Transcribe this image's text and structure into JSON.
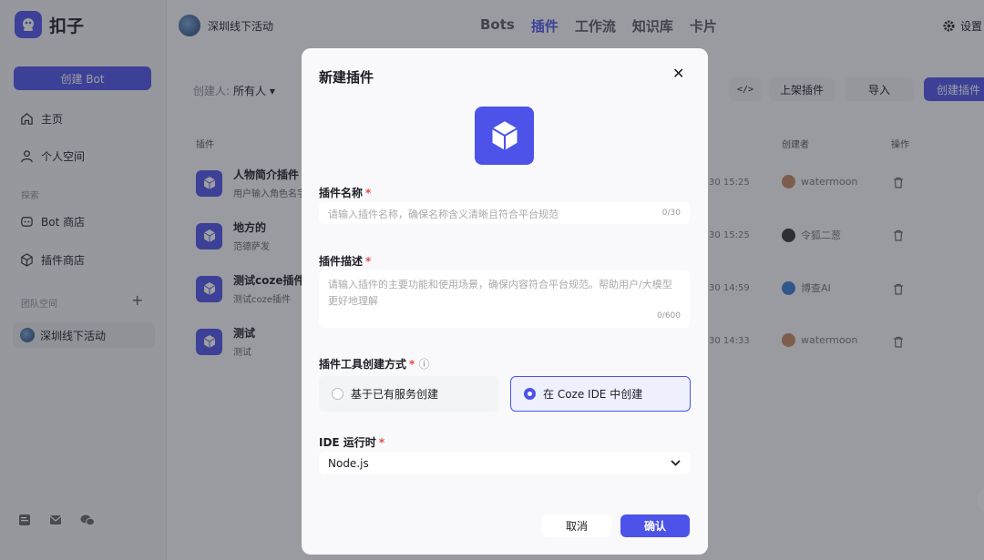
{
  "app": {
    "name": "扣子"
  },
  "sidebar": {
    "create_bot": "创建 Bot",
    "home": "主页",
    "personal": "个人空间",
    "explore_label": "探索",
    "bot_store": "Bot 商店",
    "plugin_store": "插件商店",
    "team_label": "团队空间",
    "team_item": "深圳线下活动"
  },
  "topbar": {
    "space_name": "深圳线下活动",
    "tabs": [
      "Bots",
      "插件",
      "工作流",
      "知识库",
      "卡片"
    ],
    "active_tab": "插件",
    "settings": "设置"
  },
  "list": {
    "filter_label": "创建人:",
    "filter_value": "所有人 ▾",
    "code_btn": "</>",
    "publish_btn": "上架插件",
    "import_btn": "导入",
    "create_btn": "创建插件",
    "col_plugin": "插件",
    "col_creator": "创建者",
    "col_action": "操作",
    "rows": [
      {
        "name": "人物简介插件",
        "desc": "用户输入角色名字",
        "time": "30 15:25",
        "creator": "watermoon"
      },
      {
        "name": "地方的",
        "desc": "范德萨发",
        "time": "30 15:25",
        "creator": "令狐二葱"
      },
      {
        "name": "测试coze插件",
        "desc": "测试coze插件",
        "time": "30 14:59",
        "creator": "博查AI"
      },
      {
        "name": "测试",
        "desc": "测试",
        "time": "30 14:33",
        "creator": "watermoon"
      }
    ]
  },
  "modal": {
    "title": "新建插件",
    "name_label": "插件名称",
    "name_placeholder": "请输入插件名称，确保名称含义清晰且符合平台规范",
    "name_count": "0/30",
    "desc_label": "插件描述",
    "desc_placeholder": "请输入插件的主要功能和使用场景，确保内容符合平台规范。帮助用户/大模型更好地理解",
    "desc_count": "0/600",
    "method_label": "插件工具创建方式",
    "option_existing": "基于已有服务创建",
    "option_ide": "在 Coze IDE 中创建",
    "runtime_label": "IDE 运行时",
    "runtime_value": "Node.js",
    "cancel": "取消",
    "confirm": "确认"
  },
  "colors": {
    "accent": "#4d53e8",
    "required": "#e84a4a"
  }
}
